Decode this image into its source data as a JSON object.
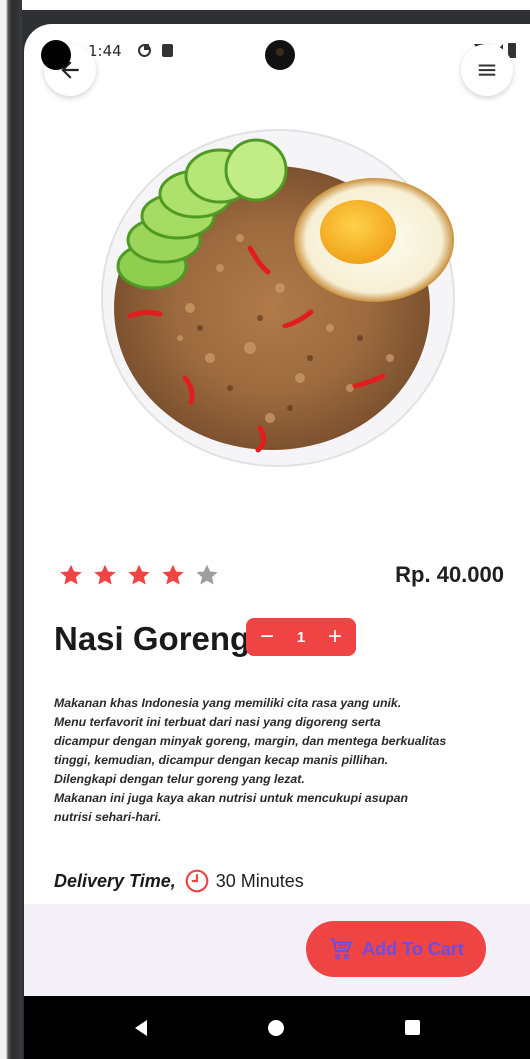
{
  "status_bar": {
    "time": "1:44",
    "icons": [
      "media-icon",
      "sd-card-icon",
      "wifi-icon",
      "signal-icon",
      "battery-icon"
    ]
  },
  "header": {
    "back_icon": "back-arrow-icon",
    "menu_icon": "hamburger-menu-icon"
  },
  "product": {
    "image_icon": "nasi-goreng-plate-image",
    "rating": 4,
    "rating_max": 5,
    "price": "Rp. 40.000",
    "name": "Nasi Goreng",
    "quantity": "1",
    "decrement_label": "−",
    "increment_label": "+",
    "description_lines": [
      "Makanan khas Indonesia yang memiliki cita rasa yang unik.",
      "Menu terfavorit ini terbuat dari nasi yang digoreng serta",
      "dicampur dengan minyak goreng, margin, dan mentega berkualitas",
      "tinggi, kemudian, dicampur dengan kecap manis pillihan.",
      "Dilengkapi dengan telur goreng yang lezat.",
      "Makanan ini juga kaya akan nutrisi untuk mencukupi asupan",
      "nutrisi sehari-hari."
    ]
  },
  "delivery": {
    "label": "Delivery Time,",
    "value": "30 Minutes",
    "icon": "clock-icon"
  },
  "cart": {
    "label": "Add To Cart",
    "icon": "cart-icon"
  },
  "colors": {
    "accent": "#ef4444",
    "star_on": "#ef4444",
    "star_off": "#9e9e9e",
    "cart_text": "#6b4de6",
    "bottom_bg": "#f3f0f7"
  },
  "navbar": {
    "icons": [
      "nav-back-icon",
      "nav-home-icon",
      "nav-recents-icon"
    ]
  }
}
